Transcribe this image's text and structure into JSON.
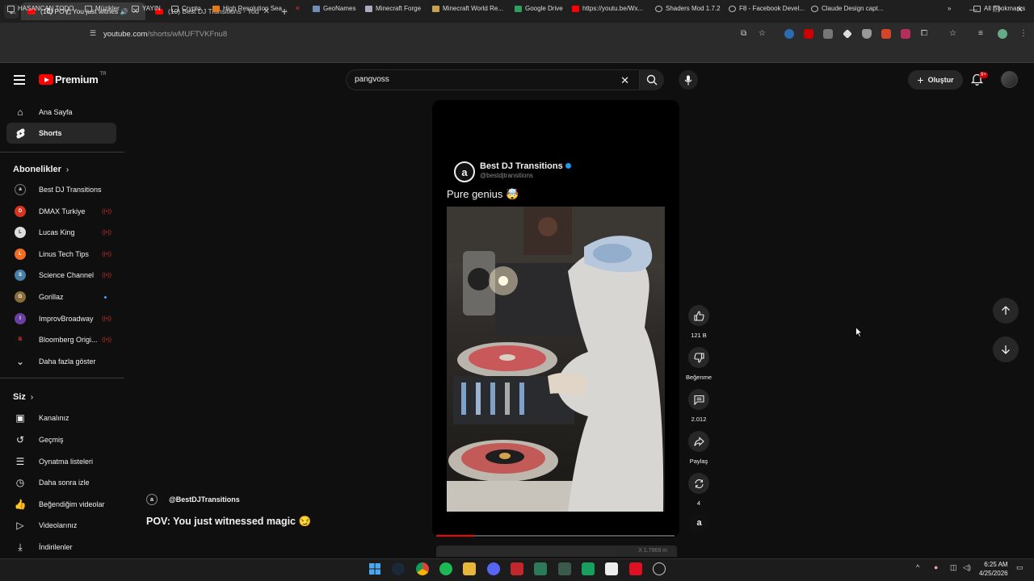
{
  "browser": {
    "tabs": [
      {
        "label": "(10) POV: You just witnesse",
        "active": true
      },
      {
        "label": "(10) Best DJ Transitions - YouTu",
        "active": false
      }
    ],
    "url_host": "youtube.com",
    "url_path": "/shorts/wMUFTVKFnu8",
    "bookmarks": [
      "HASANCAN TODO",
      "Müzikler",
      "YAYIN",
      "Crypto",
      "High Resolution Sea...",
      "GeoNames",
      "Minecraft Forge",
      "Minecraft World Re...",
      "Google Drive",
      "https://youtu.be/Wx...",
      "Shaders Mod 1.7.2",
      "F8 - Facebook Devel...",
      "Claude Design capt..."
    ],
    "all_bookmarks": "All Bookmarks"
  },
  "header": {
    "logo_text": "Premium",
    "country": "TR",
    "search_value": "pangvoss",
    "create_label": "Oluştur",
    "notif_count": "9+"
  },
  "sidebar": {
    "main": [
      {
        "label": "Ana Sayfa",
        "icon": "home-icon"
      },
      {
        "label": "Shorts",
        "icon": "shorts-icon"
      }
    ],
    "subs_title": "Abonelikler",
    "subscriptions": [
      {
        "label": "Best DJ Transitions",
        "status": "none",
        "color": "#111111"
      },
      {
        "label": "DMAX Turkiye",
        "status": "live",
        "color": "#d8341f"
      },
      {
        "label": "Lucas King",
        "status": "live",
        "color": "#dddddd"
      },
      {
        "label": "Linus Tech Tips",
        "status": "live",
        "color": "#f26b21"
      },
      {
        "label": "Science Channel",
        "status": "live",
        "color": "#4a7ea3"
      },
      {
        "label": "Gorillaz",
        "status": "new",
        "color": "#8a6d3b"
      },
      {
        "label": "ImprovBroadway",
        "status": "live",
        "color": "#6b3fa0"
      },
      {
        "label": "Bloomberg Origi...",
        "status": "live",
        "color": "#111111"
      }
    ],
    "show_more": "Daha fazla göster",
    "you_title": "Siz",
    "you": [
      {
        "label": "Kanalınız",
        "icon": "channel-icon"
      },
      {
        "label": "Geçmiş",
        "icon": "history-icon"
      },
      {
        "label": "Oynatma listeleri",
        "icon": "playlists-icon"
      },
      {
        "label": "Daha sonra izle",
        "icon": "watch-later-icon"
      },
      {
        "label": "Beğendiğim videolar",
        "icon": "liked-icon"
      },
      {
        "label": "Videolarınız",
        "icon": "your-videos-icon"
      },
      {
        "label": "İndirilenler",
        "icon": "downloads-icon"
      }
    ]
  },
  "short": {
    "post_name": "Best DJ Transitions",
    "post_handle": "@bestdjtransitions",
    "post_caption": "Pure genius 🤯",
    "channel": "@BestDJTransitions",
    "title": "POV: You just witnessed magic 😏",
    "progress": 0.16,
    "overlay_text": "X 1.7969 m"
  },
  "actions": {
    "likes": "121 B",
    "dislike": "Beğenme",
    "comments": "2.012",
    "share": "Paylaş",
    "remix": "4"
  },
  "taskbar": {
    "time": "6:25 AM",
    "date": "4/25/2026"
  },
  "colors": {
    "accent": "#ff0000",
    "background": "#0f0f0f",
    "surface": "#272727"
  }
}
